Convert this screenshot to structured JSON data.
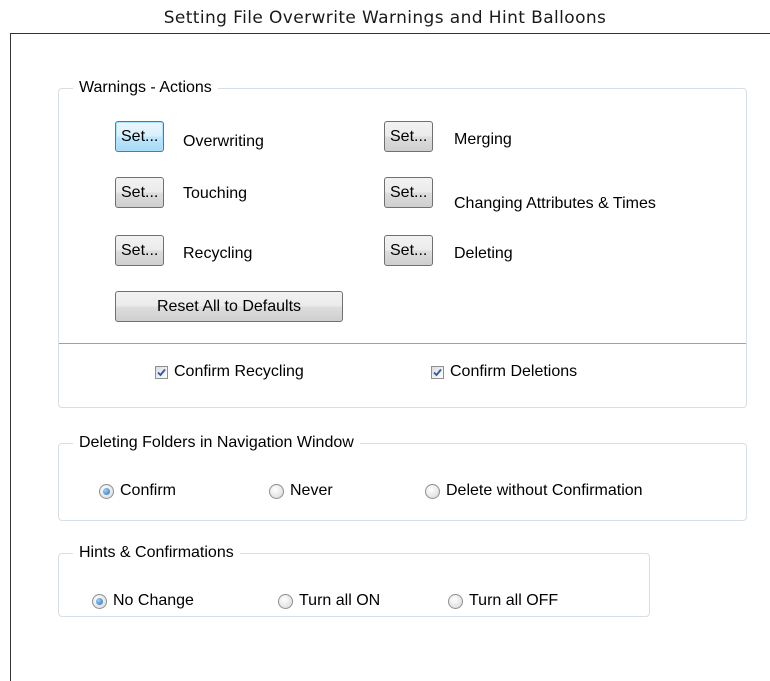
{
  "page": {
    "title": "Setting File Overwrite Warnings and Hint Balloons"
  },
  "warnings": {
    "legend": "Warnings - Actions",
    "set_label": "Set...",
    "items": [
      {
        "label": "Overwriting",
        "focused": true
      },
      {
        "label": "Touching"
      },
      {
        "label": "Recycling"
      },
      {
        "label": "Merging"
      },
      {
        "label": "Changing Attributes & Times"
      },
      {
        "label": "Deleting"
      }
    ],
    "reset_label": "Reset All to Defaults",
    "confirm_recycling": {
      "label": "Confirm Recycling",
      "checked": true
    },
    "confirm_deletions": {
      "label": "Confirm Deletions",
      "checked": true
    }
  },
  "deleting_folders": {
    "legend": "Deleting Folders in Navigation Window",
    "options": [
      {
        "label": "Confirm",
        "selected": true
      },
      {
        "label": "Never",
        "selected": false
      },
      {
        "label": "Delete without Confirmation",
        "selected": false
      }
    ]
  },
  "hints": {
    "legend": "Hints & Confirmations",
    "options": [
      {
        "label": "No Change",
        "selected": true
      },
      {
        "label": "Turn all ON",
        "selected": false
      },
      {
        "label": "Turn all OFF",
        "selected": false
      }
    ]
  },
  "colors": {
    "accent": "#1f6fbf",
    "group_border": "#d5dfe5",
    "check": "#2a5aa8"
  }
}
